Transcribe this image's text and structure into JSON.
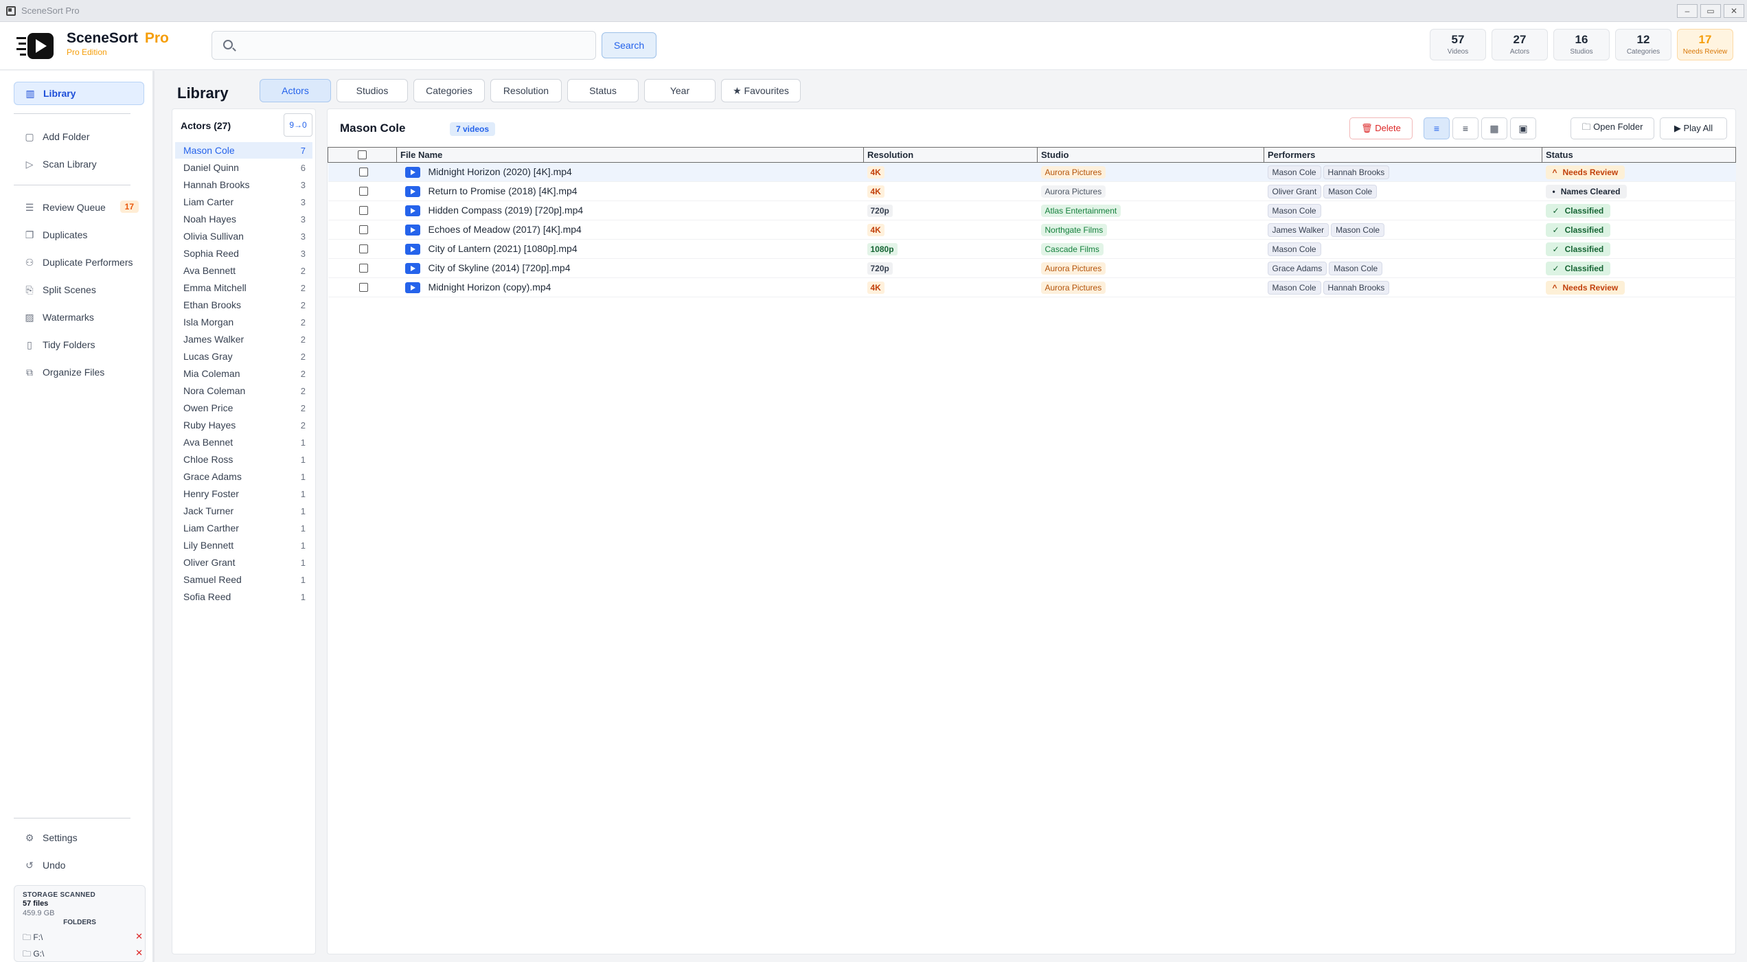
{
  "window": {
    "title": "SceneSort Pro",
    "controls": [
      "–",
      "▭",
      "✕"
    ]
  },
  "header": {
    "brand": "SceneSort",
    "brand_pro": "Pro",
    "edition": "Pro Edition",
    "search": {
      "value": "",
      "placeholder": "",
      "button": "Search"
    },
    "stats": [
      {
        "value": "57",
        "label": "Videos"
      },
      {
        "value": "27",
        "label": "Actors"
      },
      {
        "value": "16",
        "label": "Studios"
      },
      {
        "value": "12",
        "label": "Categories"
      },
      {
        "value": "17",
        "label": "Needs Review"
      }
    ]
  },
  "sidebar": {
    "items": [
      {
        "label": "Library",
        "icon": "library-icon",
        "glyph": "▥"
      },
      {
        "label": "Add Folder",
        "icon": "add-folder-icon",
        "glyph": "▢"
      },
      {
        "label": "Scan Library",
        "icon": "scan-play-icon",
        "glyph": "▷"
      },
      {
        "label": "Review Queue",
        "icon": "list-icon",
        "glyph": "☰",
        "badge": "17"
      },
      {
        "label": "Duplicates",
        "icon": "duplicates-icon",
        "glyph": "❐"
      },
      {
        "label": "Duplicate Performers",
        "icon": "user-duplicate-icon",
        "glyph": "⚇"
      },
      {
        "label": "Split Scenes",
        "icon": "split-icon",
        "glyph": "⎘"
      },
      {
        "label": "Watermarks",
        "icon": "image-icon",
        "glyph": "▨"
      },
      {
        "label": "Tidy Folders",
        "icon": "document-icon",
        "glyph": "▯"
      },
      {
        "label": "Organize Files",
        "icon": "organize-icon",
        "glyph": "⧉"
      },
      {
        "label": "Settings",
        "icon": "gear-icon",
        "glyph": "⚙"
      },
      {
        "label": "Undo",
        "icon": "undo-icon",
        "glyph": "↺"
      }
    ],
    "storage": {
      "title": "STORAGE SCANNED",
      "files": "57 files",
      "size": "459.9 GB",
      "folders_title": "FOLDERS",
      "folders": [
        {
          "path": "F:\\",
          "remove": "✕"
        },
        {
          "path": "G:\\",
          "remove": "✕"
        }
      ]
    }
  },
  "main": {
    "title": "Library",
    "tabs": [
      {
        "label": "Actors",
        "active": true
      },
      {
        "label": "Studios"
      },
      {
        "label": "Categories"
      },
      {
        "label": "Resolution"
      },
      {
        "label": "Status"
      },
      {
        "label": "Year"
      },
      {
        "label": "★ Favourites"
      }
    ]
  },
  "actors_panel": {
    "title": "Actors (27)",
    "sort_label": "9→0",
    "actors": [
      {
        "name": "Mason Cole",
        "count": "7"
      },
      {
        "name": "Daniel Quinn",
        "count": "6"
      },
      {
        "name": "Hannah Brooks",
        "count": "3"
      },
      {
        "name": "Liam Carter",
        "count": "3"
      },
      {
        "name": "Noah Hayes",
        "count": "3"
      },
      {
        "name": "Olivia Sullivan",
        "count": "3"
      },
      {
        "name": "Sophia Reed",
        "count": "3"
      },
      {
        "name": "Ava Bennett",
        "count": "2"
      },
      {
        "name": "Emma Mitchell",
        "count": "2"
      },
      {
        "name": "Ethan Brooks",
        "count": "2"
      },
      {
        "name": "Isla Morgan",
        "count": "2"
      },
      {
        "name": "James Walker",
        "count": "2"
      },
      {
        "name": "Lucas Gray",
        "count": "2"
      },
      {
        "name": "Mia Coleman",
        "count": "2"
      },
      {
        "name": "Nora Coleman",
        "count": "2"
      },
      {
        "name": "Owen Price",
        "count": "2"
      },
      {
        "name": "Ruby Hayes",
        "count": "2"
      },
      {
        "name": "Ava Bennet",
        "count": "1"
      },
      {
        "name": "Chloe Ross",
        "count": "1"
      },
      {
        "name": "Grace Adams",
        "count": "1"
      },
      {
        "name": "Henry Foster",
        "count": "1"
      },
      {
        "name": "Jack Turner",
        "count": "1"
      },
      {
        "name": "Liam Carther",
        "count": "1"
      },
      {
        "name": "Lily Bennett",
        "count": "1"
      },
      {
        "name": "Oliver Grant",
        "count": "1"
      },
      {
        "name": "Samuel Reed",
        "count": "1"
      },
      {
        "name": "Sofia Reed",
        "count": "1"
      }
    ]
  },
  "videos_panel": {
    "title": "Mason Cole",
    "count_badge": "7 videos",
    "delete_label": "🗑 Delete",
    "view_buttons": [
      "≡",
      "≡",
      "▦",
      "▣"
    ],
    "open_folder_label": "🗀 Open Folder",
    "play_all_label": "▶ Play All",
    "columns": [
      "",
      "File Name",
      "Resolution",
      "Studio",
      "Performers",
      "Status"
    ],
    "rows": [
      {
        "file": "Midnight Horizon (2020) [4K].mp4",
        "resolution": "4K",
        "studio": "Aurora Pictures",
        "performers": [
          "Mason Cole",
          "Hannah Brooks"
        ],
        "status": "Needs Review"
      },
      {
        "file": "Return to Promise (2018) [4K].mp4",
        "resolution": "4K",
        "studio": "Aurora Pictures",
        "performers": [
          "Oliver Grant",
          "Mason Cole"
        ],
        "status": "Names Cleared"
      },
      {
        "file": "Hidden Compass (2019) [720p].mp4",
        "resolution": "720p",
        "studio": "Atlas Entertainment",
        "performers": [
          "Mason Cole"
        ],
        "status": "Classified"
      },
      {
        "file": "Echoes of Meadow (2017) [4K].mp4",
        "resolution": "4K",
        "studio": "Northgate Films",
        "performers": [
          "James Walker",
          "Mason Cole"
        ],
        "status": "Classified"
      },
      {
        "file": "City of Lantern (2021) [1080p].mp4",
        "resolution": "1080p",
        "studio": "Cascade Films",
        "performers": [
          "Mason Cole"
        ],
        "status": "Classified"
      },
      {
        "file": "City of Skyline (2014) [720p].mp4",
        "resolution": "720p",
        "studio": "Aurora Pictures",
        "performers": [
          "Grace Adams",
          "Mason Cole"
        ],
        "status": "Classified"
      },
      {
        "file": "Midnight Horizon (copy).mp4",
        "resolution": "4K",
        "studio": "Aurora Pictures",
        "performers": [
          "Mason Cole",
          "Hannah Brooks"
        ],
        "status": "Needs Review"
      }
    ]
  },
  "colors": {
    "accent": "#2563eb",
    "warning": "#f59e0b",
    "danger": "#dc2626",
    "success": "#166534"
  }
}
